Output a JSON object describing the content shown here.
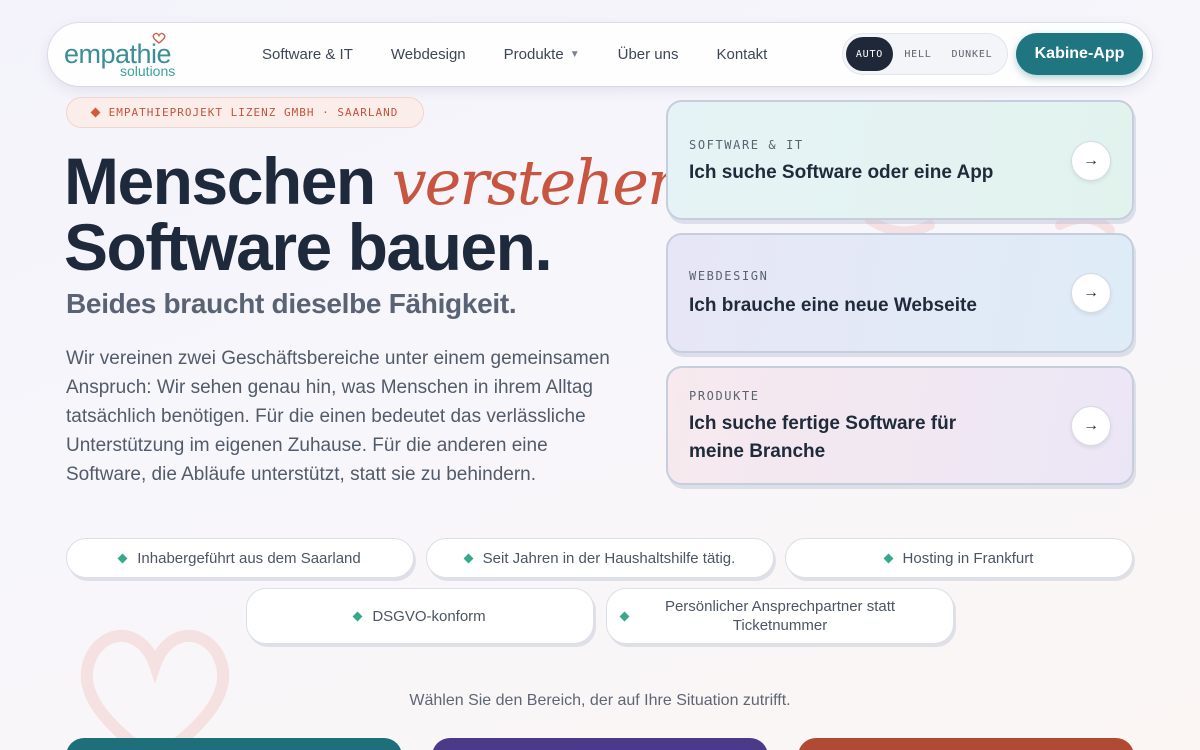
{
  "brand": {
    "name": "empathie",
    "sub": "solutions",
    "color": "#3b8e96"
  },
  "nav": {
    "links": [
      "Software & IT",
      "Webdesign",
      "Produkte",
      "Über uns",
      "Kontakt"
    ],
    "theme": {
      "options": [
        "AUTO",
        "HELL",
        "DUNKEL"
      ],
      "active": "AUTO"
    },
    "cta": "Kabine-App"
  },
  "badge": "EMPATHIEPROJEKT LIZENZ GMBH · SAARLAND",
  "hero": {
    "line1_start": "Menschen ",
    "line1_accent": "verstehen",
    "line1_end": ".",
    "line2": "Software bauen.",
    "subheadline": "Beides braucht dieselbe Fähigkeit.",
    "paragraph": "Wir vereinen zwei Geschäftsbereiche unter einem gemeinsamen Anspruch: Wir sehen genau hin, was Menschen in ihrem Alltag tatsächlich benötigen. Für die einen bedeutet das verlässliche Unterstützung im eigenen Zuhause. Für die anderen eine Software, die Abläufe unterstützt, statt sie zu behindern."
  },
  "cards": [
    {
      "kicker": "SOFTWARE & IT",
      "title": "Ich suche Software oder eine App",
      "arrow": "→"
    },
    {
      "kicker": "WEBDESIGN",
      "title": "Ich brauche eine neue Webseite",
      "arrow": "→"
    },
    {
      "kicker": "PRODUKTE",
      "title": "Ich suche fertige Software für meine Branche",
      "arrow": "→"
    }
  ],
  "pills": [
    "Inhabergeführt aus dem Saarland",
    "Seit Jahren in der Haushaltshilfe tätig.",
    "Hosting in Frankfurt",
    "DSGVO-konform",
    "Persönlicher Ansprechpartner statt Ticketnummer"
  ],
  "hint": "Wählen Sie den Bereich, der auf Ihre Situation zutrifft.",
  "colors": {
    "accent_teal": "#1f7580",
    "accent_red": "#c8553f",
    "pill_dot": "#36a88b",
    "bottom_cards": [
      "#1f6f7a",
      "#4b3a8a",
      "#b14a32"
    ]
  },
  "icons": {
    "logo_heart": "heart-icon",
    "nav_caret": "chevron-down-icon",
    "card_arrow": "arrow-right-icon",
    "badge_marker": "diamond-icon",
    "pill_marker": "diamond-icon"
  }
}
